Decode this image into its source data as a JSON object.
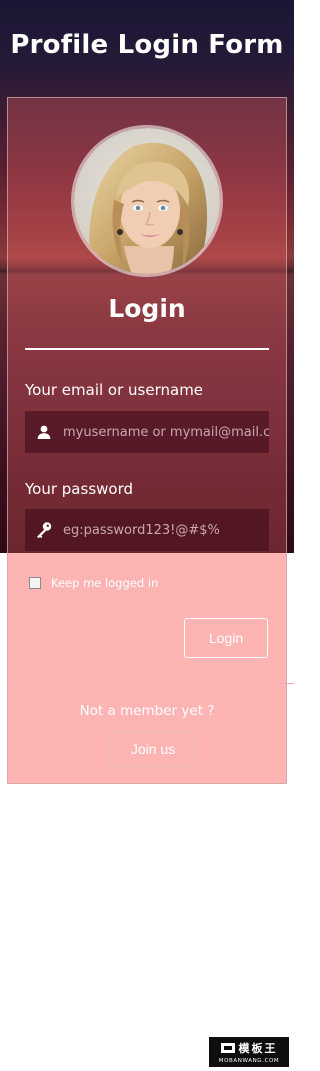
{
  "page": {
    "title": "Profile Login Form"
  },
  "login": {
    "heading": "Login",
    "email_label": "Your email or username",
    "email_placeholder": "myusername or mymail@mail.com",
    "email_icon": "user-icon",
    "password_label": "Your password",
    "password_placeholder": "eg:password123!@#$%",
    "password_icon": "key-icon",
    "keep_logged_in_label": "Keep me logged in",
    "keep_logged_in_checked": false,
    "submit_label": "Login"
  },
  "signup": {
    "prompt": "Not a member yet ?",
    "join_label": "Join us"
  },
  "watermark": {
    "brand": "模板王",
    "site": "MOBANWANG.COM"
  },
  "colors": {
    "panel_tint": "#ff6e6e",
    "text": "#ffffff",
    "background_dark": "#241a38"
  }
}
